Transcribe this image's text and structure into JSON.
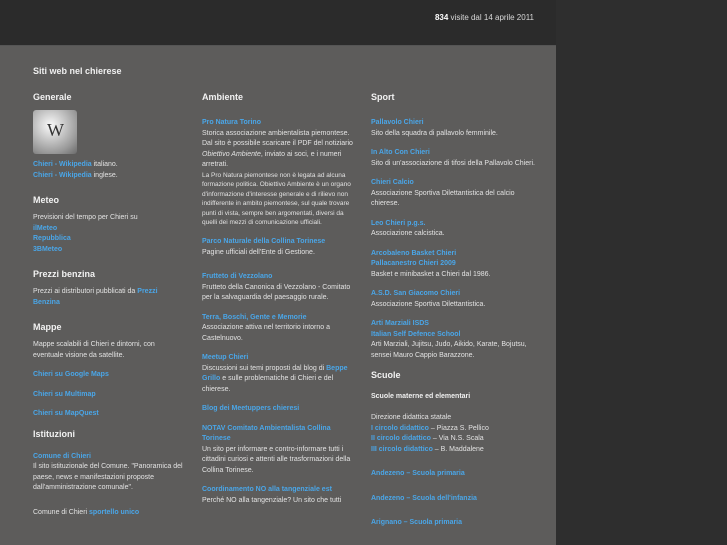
{
  "header": {
    "count": "834",
    "since": " visite dal 14 aprile 2011"
  },
  "site_title": "Siti web nel chierese",
  "col1": {
    "generale_title": "Generale",
    "wiki_glyph": "W",
    "wiki_it_link": "Chieri - Wikipedia",
    "wiki_it_text": " italiano.",
    "wiki_en_link": "Chieri - Wikipedia",
    "wiki_en_text": " inglese.",
    "meteo_title": "Meteo",
    "meteo_text": "Previsioni del tempo per Chieri su",
    "meteo_links": [
      "ilMeteo",
      "Repubblica",
      "3BMeteo"
    ],
    "benzina_title": "Prezzi benzina",
    "benzina_text": "Prezzi ai distributori pubblicati da ",
    "benzina_link1": "Prezzi",
    "benzina_link2": "Benzina",
    "mappe_title": "Mappe",
    "mappe_text": "Mappe scalabili di Chieri e dintorni, con eventuale visione da satellite.",
    "mappe_links": [
      "Chieri su Google Maps",
      "Chieri su Multimap",
      "Chieri su MapQuest"
    ],
    "istituzioni_title": "Istituzioni",
    "comune_link": "Comune di Chieri",
    "comune_text": "Il sito istituzionale del Comune. \"Panoramica del paese, news e manifestazioni proposte dall'amministrazione comunale\".",
    "sportello_text": "Comune di Chieri ",
    "sportello_link": "sportello unico"
  },
  "col2": {
    "title": "Ambiente",
    "pronatura_link": "Pro Natura Torino",
    "pronatura_text1": "Storica associazione ambientalista piemontese. Dal sito è possibile scaricare il PDF del notiziario ",
    "pronatura_italic": "Obiettivo Ambiente",
    "pronatura_text2": ", inviato ai soci, e i numeri arretrati.",
    "pronatura_small": "La Pro Natura piemontese non è legata ad alcuna formazione politica. Obiettivo Ambiente è un organo d'informazione d'interesse generale e di rilievo non indifferente in ambito piemontese, sul quale trovare punti di vista, sempre ben argomentati, diversi da quelli dei mezzi di comunicazione ufficiali.",
    "parco_link": "Parco Naturale della Collina Torinese",
    "parco_text": "Pagine ufficiali dell'Ente di Gestione.",
    "frutteto_link": "Frutteto di Vezzolano",
    "frutteto_text": "Frutteto della Canonica di Vezzolano - Comitato per la salvaguardia del paesaggio rurale.",
    "terra_link": "Terra, Boschi, Gente e Memorie",
    "terra_text": "Associazione attiva nel territorio intorno a Castelnuovo.",
    "meetup_link": "Meetup Chieri",
    "meetup_text1": "Discussioni sui temi proposti dal blog di ",
    "meetup_link2a": "Beppe",
    "meetup_link2b": "Grillo",
    "meetup_text2": " e sulle problematiche di Chieri e del chierese.",
    "blog_link": "Blog dei Meetuppers chieresi",
    "notav_link": "NOTAV Comitato Ambientalista Collina Torinese",
    "notav_text": "Un sito per informare e contro-informare tutti i cittadini curiosi e attenti alle trasformazioni della Collina Torinese.",
    "coord_link": "Coordinamento NO alla tangenziale est",
    "coord_text": "Perché NO alla tangenziale? Un sito che tutti"
  },
  "col3": {
    "title": "Sport",
    "pallavolo_link": "Pallavolo Chieri",
    "pallavolo_text": "Sito della squadra di pallavolo femminile.",
    "inalto_link": "In Alto Con Chieri",
    "inalto_text": "Sito di un'associazione di tifosi della Pallavolo Chieri.",
    "calcio_link": "Chieri Calcio",
    "calcio_text": "Associazione Sportiva Dilettantistica del calcio chierese.",
    "leo_link": "Leo Chieri p.g.s.",
    "leo_text": "Associazione calcistica.",
    "arco_link1": "Arcobaleno Basket Chieri",
    "arco_link2": "Pallacanestro Chieri 2009",
    "arco_text": "Basket e minibasket a Chieri dal 1986.",
    "asd_link": "A.S.D. San Giacomo Chieri",
    "asd_text": "Associazione Sportiva Dilettantistica.",
    "arti_link1": "Arti Marziali ISDS",
    "arti_link2": "Italian Self Defence School",
    "arti_text": "Arti Marziali, Jujitsu, Judo, Aikido, Karate, Bojutsu, sensei Mauro Cappio Barazzone.",
    "scuole_title": "Scuole",
    "scuole_sub": "Scuole materne ed elementari",
    "direzione_text": "Direzione didattica statale",
    "circoli": [
      {
        "link": "I circolo didattico",
        "text": " – Piazza S. Pellico"
      },
      {
        "link": "II circolo didattico",
        "text": " – Via N.S. Scala"
      },
      {
        "link": "III circolo didattico",
        "text": " – B. Maddalene"
      }
    ],
    "andezeno1": "Andezeno – Scuola primaria",
    "andezeno2": "Andezeno – Scuola dell'infanzia",
    "arignano": "Arignano – Scuola primaria"
  }
}
